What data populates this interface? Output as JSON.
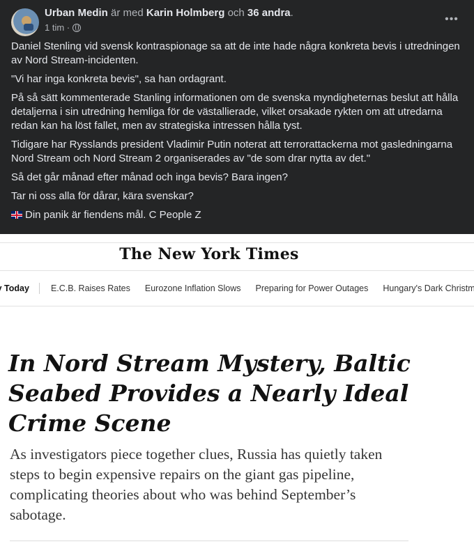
{
  "post": {
    "author": "Urban Medin",
    "with_text": "är med",
    "tagged": "Karin Holmberg",
    "and_text": "och",
    "others": "36 andra",
    "period": ".",
    "time": "1 tim ·",
    "more_label": "•••",
    "paragraphs": [
      "Daniel Stenling vid svensk kontraspionage sa att de inte hade några konkreta bevis i utredningen av Nord Stream-incidenten.",
      "\"Vi har inga konkreta bevis\", sa han ordagrant.",
      "På så sätt kommenterade Stanling informationen om de svenska myndigheternas beslut att hålla detaljerna i sin utredning hemliga för de västallierade, vilket orsakade rykten om att utredarna redan kan ha löst fallet, men av strategiska intressen hålla tyst.",
      "Tidigare har Rysslands president Vladimir Putin noterat att terrorattackerna mot gasledningarna Nord Stream och Nord Stream 2 organiserades av \"de som drar nytta av det.\"",
      "Så det går månad efter månad och inga bevis? Bara ingen?",
      "Tar ni oss alla för dårar, kära svenskar?"
    ],
    "signature": "Din panik är fiendens mål. C People Z"
  },
  "nyt": {
    "masthead": "The New York Times",
    "nav": [
      "ny Today",
      "E.C.B. Raises Rates",
      "Eurozone Inflation Slows",
      "Preparing for Power Outages",
      "Hungary's Dark Christmas"
    ],
    "headline": "In Nord Stream Mystery, Baltic Seabed Provides a Nearly Ideal Crime Scene",
    "summary": "As investigators piece together clues, Russia has quietly taken steps to begin expensive repairs on the giant gas pipeline, complicating theories about who was behind September’s sabotage."
  },
  "colors": {
    "post_bg": "#242526",
    "post_text": "#e4e6eb",
    "post_muted": "#b0b3b8",
    "nyt_bg": "#ffffff"
  },
  "icons": [
    "globe-icon",
    "more-icon",
    "uk-flag-icon",
    "avatar"
  ]
}
